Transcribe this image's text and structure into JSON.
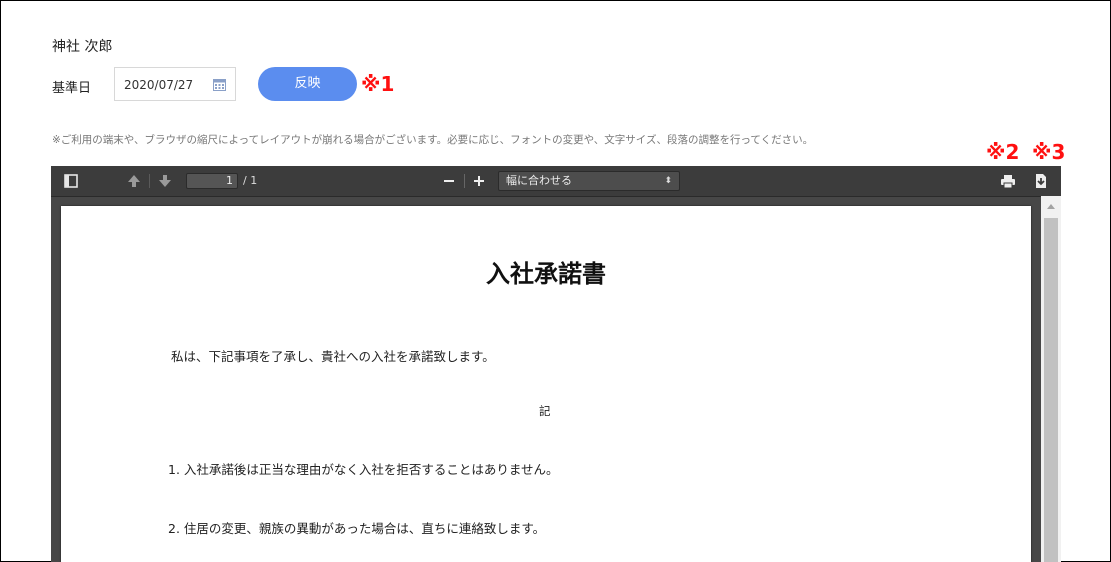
{
  "header": {
    "user_name": "神社 次郎",
    "date_label": "基準日",
    "date_value": "2020/07/27",
    "apply_label": "反映"
  },
  "notes": {
    "mark1": "※1",
    "mark2": "※2",
    "mark3": "※3",
    "notice": "※ご利用の端末や、ブラウザの縮尺によってレイアウトが崩れる場合がございます。必要に応じ、フォントの変更や、文字サイズ、段落の調整を行ってください。"
  },
  "viewer": {
    "page_number": "1",
    "page_total": "/ 1",
    "zoom_label": "幅に合わせる",
    "zoom_minus": "−",
    "zoom_plus": "+",
    "zoom_arrows": "⬍",
    "icons": [
      "sidebar-toggle-icon",
      "arrow-up-icon",
      "arrow-down-icon",
      "print-icon",
      "download-icon"
    ]
  },
  "document": {
    "title": "入社承諾書",
    "intro": "私は、下記事項を了承し、貴社への入社を承諾致します。",
    "ki": "記",
    "items": [
      "1.  入社承諾後は正当な理由がなく入社を拒否することはありません。",
      "2.  住居の変更、親族の異動があった場合は、直ちに連絡致します。"
    ]
  },
  "colors": {
    "accent": "#5b8def",
    "note_red": "#ff1010",
    "toolbar": "#3c3c3c"
  }
}
